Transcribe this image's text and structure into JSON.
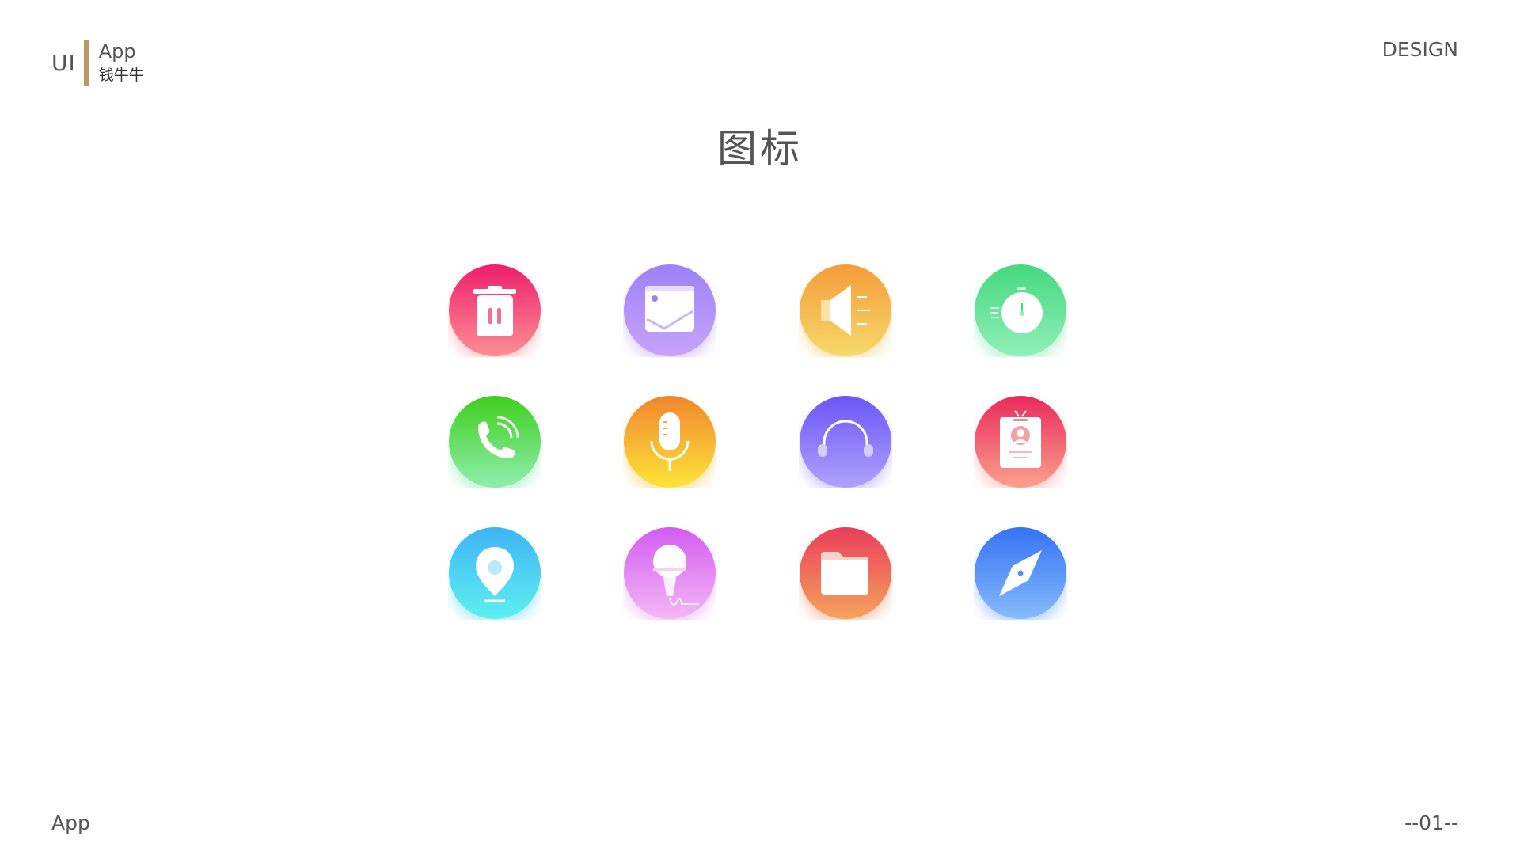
{
  "header": {
    "brand_ui": "UI",
    "brand_app": "App",
    "brand_cn": "钱牛牛",
    "brand_bar_color": "#b89a63",
    "design_label": "DESIGN"
  },
  "title": "图标",
  "icons": [
    {
      "name": "trash-icon",
      "gradient": [
        "#ee1f6c",
        "#fb8f95"
      ]
    },
    {
      "name": "image-icon",
      "gradient": [
        "#9b83f6",
        "#c8a3fb"
      ]
    },
    {
      "name": "speaker-icon",
      "gradient": [
        "#f59c3a",
        "#f7d96a"
      ]
    },
    {
      "name": "timer-icon",
      "gradient": [
        "#45d880",
        "#8ff0b8"
      ]
    },
    {
      "name": "phone-icon",
      "gradient": [
        "#3fcf1d",
        "#90eeb0"
      ]
    },
    {
      "name": "microphone-icon",
      "gradient": [
        "#f0862d",
        "#fde638"
      ]
    },
    {
      "name": "headphones-icon",
      "gradient": [
        "#6a56f7",
        "#b0a2fb"
      ]
    },
    {
      "name": "id-badge-icon",
      "gradient": [
        "#ea2a5c",
        "#fba18d"
      ]
    },
    {
      "name": "location-pin-icon",
      "gradient": [
        "#3eb4f5",
        "#5ef0f0"
      ]
    },
    {
      "name": "karaoke-mic-icon",
      "gradient": [
        "#d45cf3",
        "#f4b8f4"
      ]
    },
    {
      "name": "folder-icon",
      "gradient": [
        "#ea3d5c",
        "#f6a35d"
      ]
    },
    {
      "name": "compass-icon",
      "gradient": [
        "#3672f6",
        "#85bcfb"
      ]
    }
  ],
  "footer": {
    "left": "App",
    "right": "--01--"
  }
}
